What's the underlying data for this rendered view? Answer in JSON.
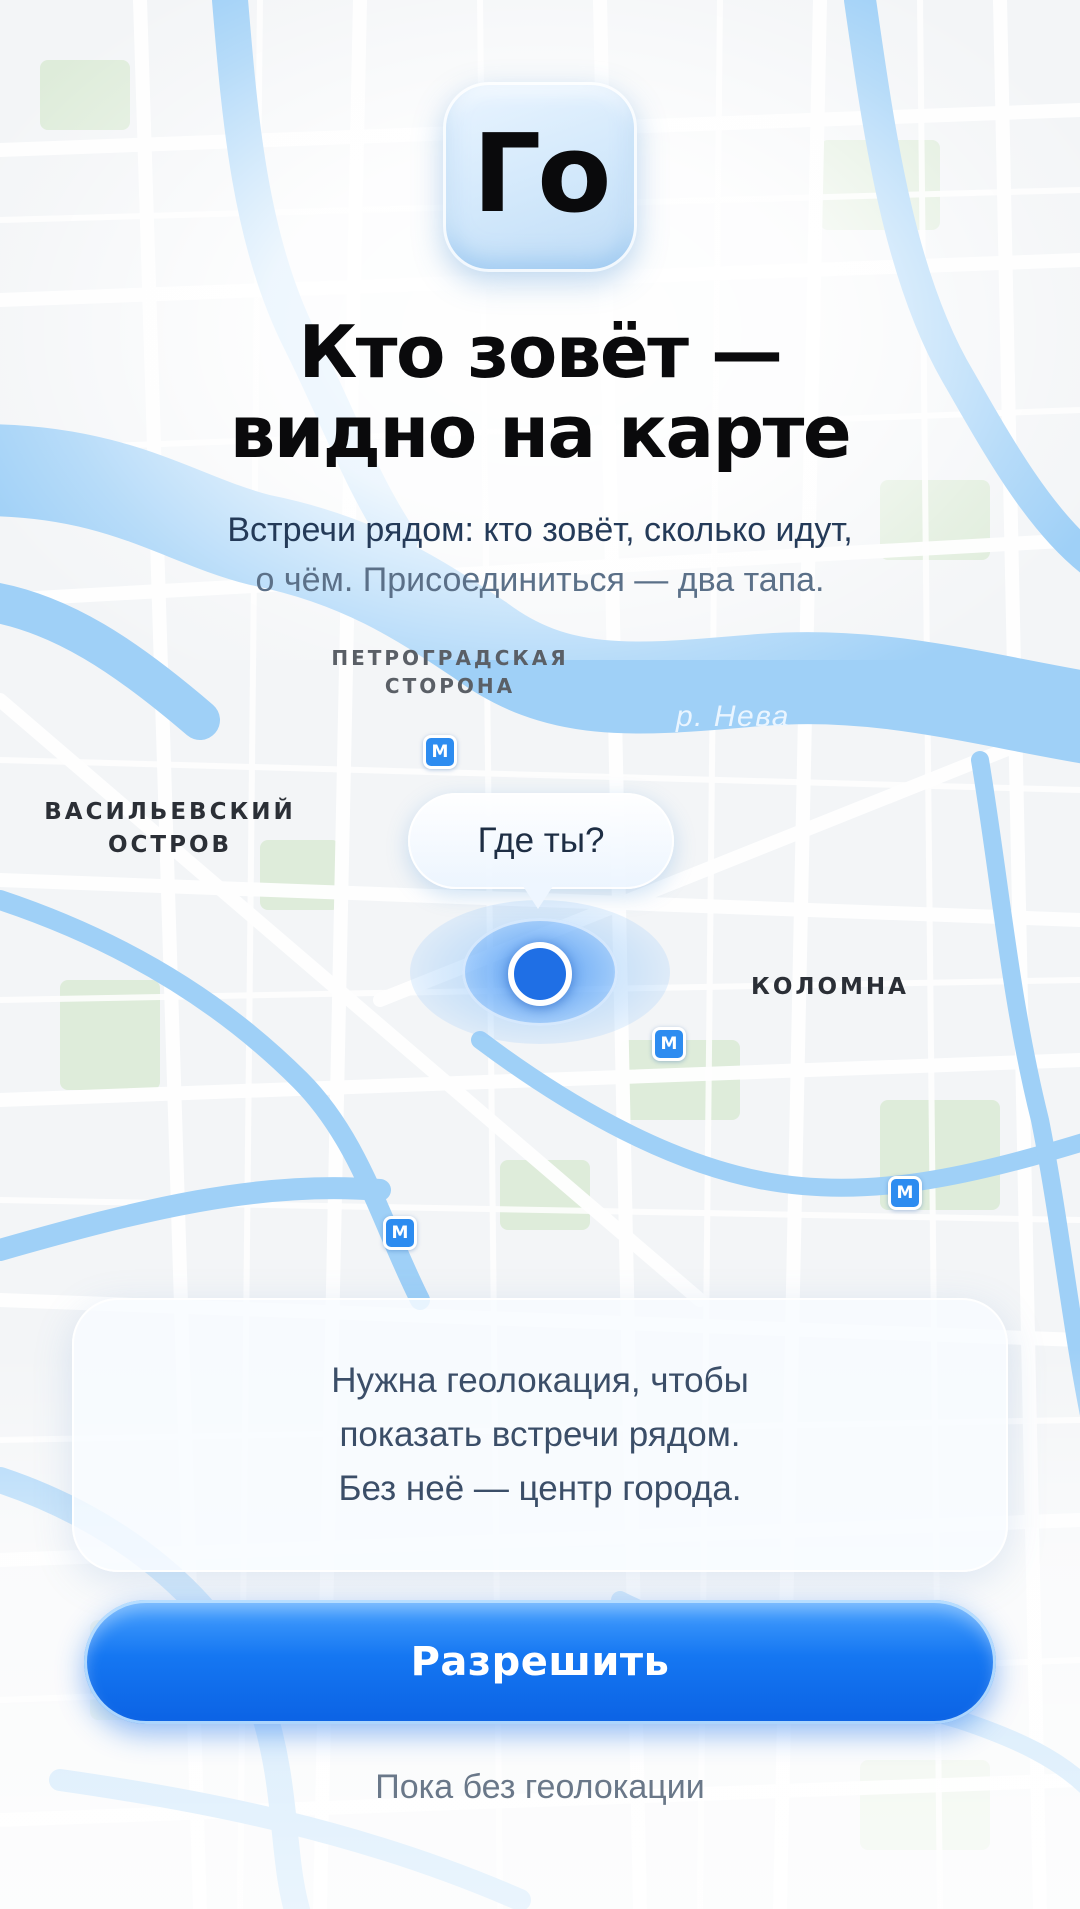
{
  "app_icon": {
    "label": "Го"
  },
  "headline": {
    "line1": "Кто зовёт —",
    "line2": "видно на карте"
  },
  "subtitle": {
    "line1": "Встречи рядом: кто зовёт, сколько идут,",
    "line2": "о чём. Присоединиться — два тапа."
  },
  "map": {
    "labels": {
      "petrogradskaya": "ПЕТРОГРАДСКАЯ\nСТОРОНА",
      "vasilievsky": "ВАСИЛЬЕВСКИЙ\nОСТРОВ",
      "kolomna": "КОЛОМНА",
      "river": "р. Нева"
    },
    "metro_icon_glyph": "М",
    "speech_bubble": "Где ты?",
    "colors": {
      "water": "#9fd0f7",
      "land": "#f4f6f8",
      "road": "#ffffff",
      "park": "#dcebd6",
      "accent": "#1577f2"
    }
  },
  "info_card": {
    "text": "Нужна геолокация, чтобы\nпоказать встречи рядом.\nБез неё — центр города."
  },
  "buttons": {
    "allow": "Разрешить",
    "skip": "Пока без геолокации"
  }
}
